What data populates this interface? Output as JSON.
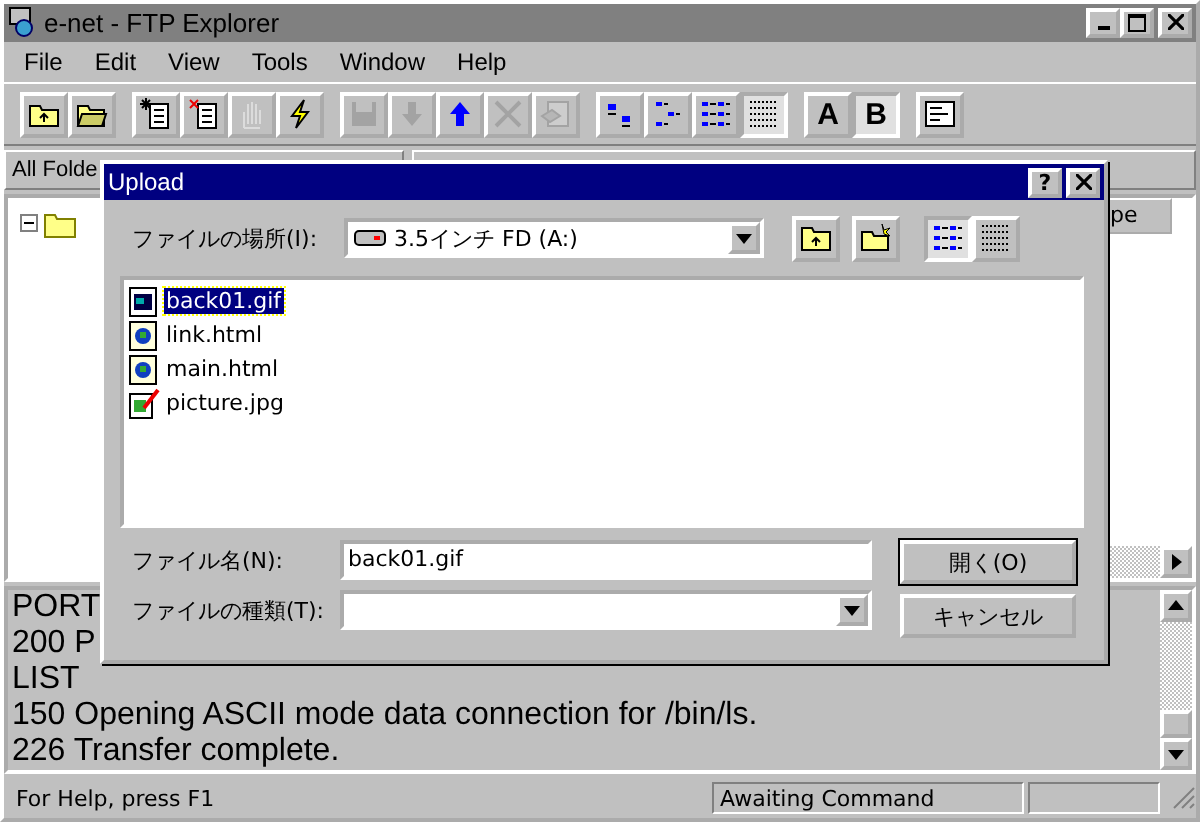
{
  "window": {
    "title": "e-net - FTP Explorer"
  },
  "menu": [
    "File",
    "Edit",
    "View",
    "Tools",
    "Window",
    "Help"
  ],
  "toolbar": [
    [
      {
        "disabled": false,
        "selected": false
      },
      {
        "disabled": false,
        "selected": false
      }
    ],
    [
      {
        "disabled": false,
        "selected": false
      },
      {
        "disabled": false,
        "selected": false
      },
      {
        "disabled": true,
        "selected": false
      },
      {
        "disabled": false,
        "selected": false
      }
    ],
    [
      {
        "disabled": true,
        "selected": false
      },
      {
        "disabled": true,
        "selected": false
      },
      {
        "disabled": false,
        "selected": false
      },
      {
        "disabled": true,
        "selected": false
      },
      {
        "disabled": true,
        "selected": false
      }
    ],
    [
      {
        "disabled": false,
        "selected": false
      },
      {
        "disabled": false,
        "selected": false
      },
      {
        "disabled": false,
        "selected": false
      },
      {
        "disabled": false,
        "selected": true
      }
    ],
    [
      {
        "label": "A",
        "disabled": false,
        "selected": false
      },
      {
        "label": "B",
        "disabled": false,
        "selected": true
      }
    ],
    [
      {
        "disabled": false,
        "selected": false
      }
    ]
  ],
  "folders_pane": {
    "header": "All Folde",
    "tree": [
      {
        "expanded": true
      }
    ]
  },
  "contents_pane": {
    "column_header": "pe"
  },
  "log": [
    "PORT",
    "200 P",
    "LIST",
    "150 Opening ASCII mode data connection for /bin/ls.",
    "226 Transfer complete."
  ],
  "status_bar": [
    "For Help, press F1",
    "Awaiting Command"
  ],
  "dialog": {
    "title": "Upload",
    "help": "?",
    "location": {
      "label": "ファイルの場所(I):",
      "value": "3.5インチ FD (A:)"
    },
    "view_buttons": [
      {
        "selected": true
      },
      {
        "selected": false
      }
    ],
    "files": [
      {
        "name": "back01.gif",
        "kind": "gif",
        "selected": true
      },
      {
        "name": "link.html",
        "kind": "html",
        "selected": false
      },
      {
        "name": "main.html",
        "kind": "html",
        "selected": false
      },
      {
        "name": "picture.jpg",
        "kind": "jpg",
        "selected": false
      }
    ],
    "filename": {
      "label": "ファイル名(N):",
      "value": "back01.gif"
    },
    "filetype": {
      "label": "ファイルの種類(T):"
    },
    "buttons": [
      {
        "label": "開く(O)",
        "default": true
      },
      {
        "label": "キャンセル",
        "default": false
      }
    ]
  }
}
